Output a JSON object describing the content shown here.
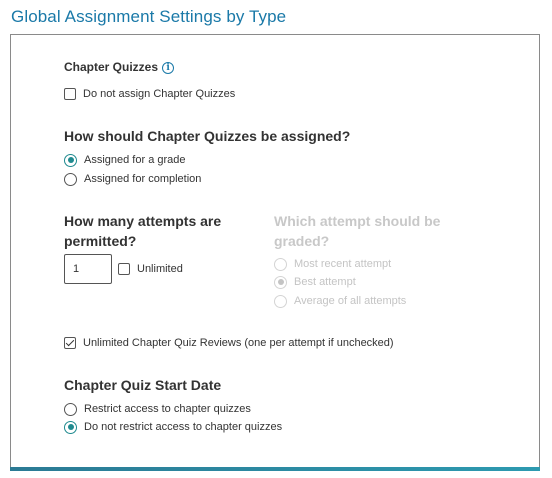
{
  "page": {
    "title": "Global Assignment Settings by Type"
  },
  "chapter_quizzes": {
    "label": "Chapter Quizzes",
    "info_icon": "info-icon",
    "do_not_assign": {
      "label": "Do not assign Chapter Quizzes",
      "checked": false
    }
  },
  "assignment_type": {
    "heading": "How should Chapter Quizzes be assigned?",
    "options": [
      {
        "label": "Assigned for a grade",
        "checked": true
      },
      {
        "label": "Assigned for completion",
        "checked": false
      }
    ]
  },
  "attempts": {
    "heading_line1": "How many attempts are",
    "heading_line2": "permitted?",
    "value": "1",
    "unlimited": {
      "label": "Unlimited",
      "checked": false
    }
  },
  "graded_attempt": {
    "heading_line1": "Which attempt should be",
    "heading_line2": "graded?",
    "disabled": true,
    "options": [
      {
        "label": "Most recent attempt",
        "checked": false
      },
      {
        "label": "Best attempt",
        "checked": true
      },
      {
        "label": "Average of all attempts",
        "checked": false
      }
    ]
  },
  "reviews": {
    "label": "Unlimited Chapter Quiz Reviews (one per attempt if unchecked)",
    "checked": true
  },
  "start_date": {
    "heading": "Chapter Quiz Start Date",
    "options": [
      {
        "label": "Restrict access to chapter quizzes",
        "checked": false
      },
      {
        "label": "Do not restrict access to chapter quizzes",
        "checked": true
      }
    ]
  },
  "colors": {
    "title": "#1a79a8",
    "accent": "#1f8a8f",
    "bottom_bar": "#2b7a94"
  }
}
